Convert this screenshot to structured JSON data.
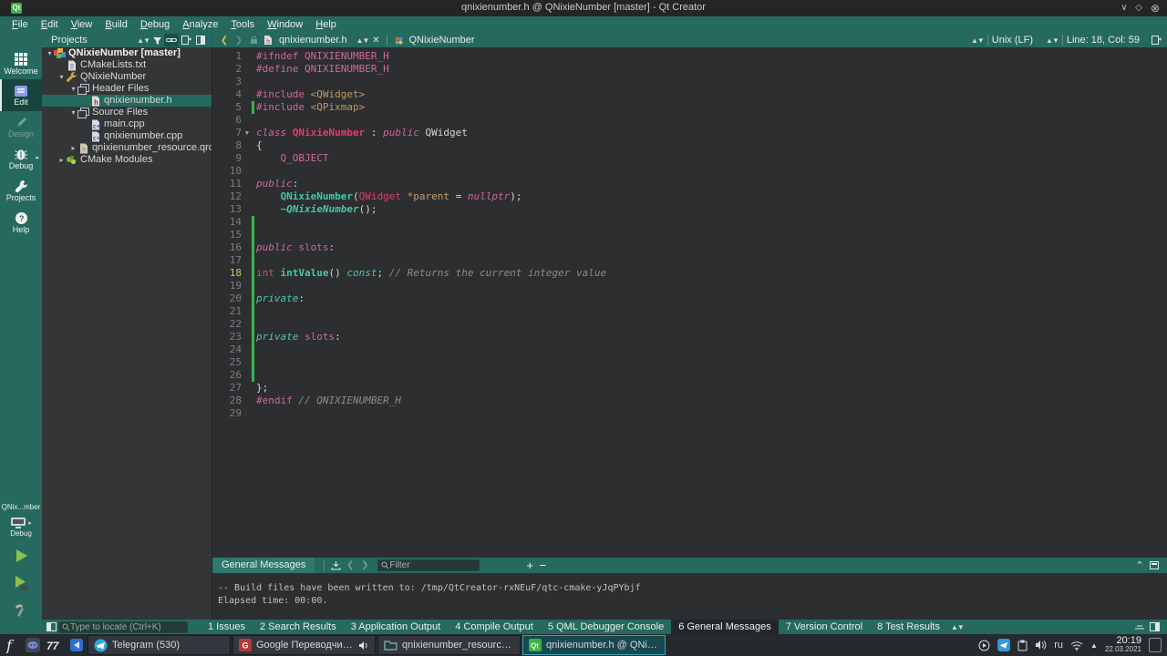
{
  "window": {
    "title": "qnixienumber.h @ QNixieNumber [master] - Qt Creator",
    "controls": [
      "minimize",
      "maximize",
      "close"
    ]
  },
  "menu_bar": {
    "items": [
      "File",
      "Edit",
      "View",
      "Build",
      "Debug",
      "Analyze",
      "Tools",
      "Window",
      "Help"
    ]
  },
  "toolbar": {
    "panel_selector": "Projects",
    "open_document": "qnixienumber.h",
    "symbol_selector": "QNixieNumber",
    "line_ending": "Unix (LF)",
    "cursor_position": "Line: 18, Col: 59"
  },
  "mode_sidebar": {
    "modes": [
      {
        "label": "Welcome",
        "icon": "welcome-grid-icon",
        "state": "normal"
      },
      {
        "label": "Edit",
        "icon": "edit-document-icon",
        "state": "selected"
      },
      {
        "label": "Design",
        "icon": "design-pencil-icon",
        "state": "disabled"
      },
      {
        "label": "Debug",
        "icon": "debug-bug-icon",
        "state": "normal",
        "has_arrow": true
      },
      {
        "label": "Projects",
        "icon": "projects-wrench-icon",
        "state": "normal"
      },
      {
        "label": "Help",
        "icon": "help-question-icon",
        "state": "normal"
      }
    ],
    "kit": {
      "target": "QNix...mber",
      "build_config": "Debug"
    }
  },
  "project_tree": {
    "items": [
      {
        "depth": 0,
        "arrow": "expanded",
        "icon": "project-icon",
        "label": "QNixieNumber [master]",
        "bold": true,
        "selected": false
      },
      {
        "depth": 1,
        "arrow": "none",
        "icon": "file-txt-icon",
        "label": "CMakeLists.txt",
        "bold": false,
        "selected": false
      },
      {
        "depth": 1,
        "arrow": "expanded",
        "icon": "wrench-icon",
        "label": "QNixieNumber",
        "bold": false,
        "selected": false
      },
      {
        "depth": 2,
        "arrow": "expanded",
        "icon": "folder-group-icon",
        "label": "Header Files",
        "bold": false,
        "selected": false
      },
      {
        "depth": 3,
        "arrow": "none",
        "icon": "file-h-icon",
        "label": "qnixienumber.h",
        "bold": false,
        "selected": true
      },
      {
        "depth": 2,
        "arrow": "expanded",
        "icon": "folder-group-icon",
        "label": "Source Files",
        "bold": false,
        "selected": false
      },
      {
        "depth": 3,
        "arrow": "none",
        "icon": "file-cpp-icon",
        "label": "main.cpp",
        "bold": false,
        "selected": false
      },
      {
        "depth": 3,
        "arrow": "none",
        "icon": "file-cpp-icon",
        "label": "qnixienumber.cpp",
        "bold": false,
        "selected": false
      },
      {
        "depth": 2,
        "arrow": "collapsed",
        "icon": "file-qrc-icon",
        "label": "qnixienumber_resource.qrc",
        "bold": false,
        "selected": false
      },
      {
        "depth": 1,
        "arrow": "collapsed",
        "icon": "cmake-modules-icon",
        "label": "CMake Modules",
        "bold": false,
        "selected": false
      }
    ]
  },
  "editor": {
    "current_line": 18,
    "fold_line": 7,
    "changed_lines": [
      5,
      14,
      15,
      16,
      17,
      18,
      19,
      20,
      21,
      22,
      23,
      24,
      25,
      26
    ],
    "lines": [
      {
        "n": 1,
        "t": [
          [
            "#ifndef QNIXIENUMBER_H",
            "pre"
          ]
        ]
      },
      {
        "n": 2,
        "t": [
          [
            "#define QNIXIENUMBER_H",
            "pre"
          ]
        ]
      },
      {
        "n": 3,
        "t": []
      },
      {
        "n": 4,
        "t": [
          [
            "#include ",
            "pre"
          ],
          [
            "<QWidget>",
            "str"
          ]
        ]
      },
      {
        "n": 5,
        "t": [
          [
            "#include ",
            "pre"
          ],
          [
            "<QPixmap>",
            "str"
          ]
        ]
      },
      {
        "n": 6,
        "t": []
      },
      {
        "n": 7,
        "t": [
          [
            "class ",
            "kw"
          ],
          [
            "QNixieNumber",
            "cls"
          ],
          [
            " : ",
            "txt"
          ],
          [
            "public",
            "kw"
          ],
          [
            " QWidget",
            "txt"
          ]
        ]
      },
      {
        "n": 8,
        "t": [
          [
            "{",
            "txt"
          ]
        ]
      },
      {
        "n": 9,
        "t": [
          [
            "    Q_OBJECT",
            "pre"
          ]
        ]
      },
      {
        "n": 10,
        "t": []
      },
      {
        "n": 11,
        "t": [
          [
            "public",
            "kw"
          ],
          [
            ":",
            "txt"
          ]
        ]
      },
      {
        "n": 12,
        "t": [
          [
            "    ",
            "txt"
          ],
          [
            "QNixieNumber",
            "fn"
          ],
          [
            "(",
            "txt"
          ],
          [
            "QWidget",
            "typ"
          ],
          [
            " ",
            "txt"
          ],
          [
            "*parent",
            "par"
          ],
          [
            " = ",
            "txt"
          ],
          [
            "nullptr",
            "kw"
          ],
          [
            ");",
            "txt"
          ]
        ]
      },
      {
        "n": 13,
        "t": [
          [
            "    ",
            "txt"
          ],
          [
            "~QNixieNumber",
            "fni"
          ],
          [
            "();",
            "txt"
          ]
        ]
      },
      {
        "n": 14,
        "t": []
      },
      {
        "n": 15,
        "t": []
      },
      {
        "n": 16,
        "t": [
          [
            "public",
            "kw"
          ],
          [
            " ",
            "txt"
          ],
          [
            "slots",
            "pre"
          ],
          [
            ":",
            "txt"
          ]
        ]
      },
      {
        "n": 17,
        "t": []
      },
      {
        "n": 18,
        "t": [
          [
            "int",
            "int"
          ],
          [
            " ",
            "txt"
          ],
          [
            "intValue",
            "fn"
          ],
          [
            "()",
            "txt"
          ],
          [
            " ",
            "txt"
          ],
          [
            "const",
            "kw2"
          ],
          [
            "; ",
            "txt"
          ],
          [
            "// Returns the current integer value",
            "cmt"
          ]
        ]
      },
      {
        "n": 19,
        "t": []
      },
      {
        "n": 20,
        "t": [
          [
            "private",
            "kw2"
          ],
          [
            ":",
            "txt"
          ]
        ]
      },
      {
        "n": 21,
        "t": []
      },
      {
        "n": 22,
        "t": []
      },
      {
        "n": 23,
        "t": [
          [
            "private",
            "kw2"
          ],
          [
            " ",
            "txt"
          ],
          [
            "slots",
            "pre"
          ],
          [
            ":",
            "txt"
          ]
        ]
      },
      {
        "n": 24,
        "t": []
      },
      {
        "n": 25,
        "t": []
      },
      {
        "n": 26,
        "t": []
      },
      {
        "n": 27,
        "t": [
          [
            "};",
            "txt"
          ]
        ]
      },
      {
        "n": 28,
        "t": [
          [
            "#endif ",
            "pre"
          ],
          [
            "// QNIXIENUMBER_H",
            "cmt"
          ]
        ]
      },
      {
        "n": 29,
        "t": []
      }
    ]
  },
  "output_pane": {
    "title": "General Messages",
    "filter_placeholder": "Filter",
    "lines": [
      "-- Build files have been written to: /tmp/QtCreator-rxNEuF/qtc-cmake-yJqPYbjf",
      "Elapsed time: 00:00."
    ]
  },
  "status_bar": {
    "locate_placeholder": "Type to locate (Ctrl+K)",
    "tabs": [
      {
        "label": "1 Issues",
        "active": false
      },
      {
        "label": "2 Search Results",
        "active": false
      },
      {
        "label": "3 Application Output",
        "active": false
      },
      {
        "label": "4 Compile Output",
        "active": false
      },
      {
        "label": "5 QML Debugger Console",
        "active": false
      },
      {
        "label": "6 General Messages",
        "active": true
      },
      {
        "label": "7 Version Control",
        "active": false
      },
      {
        "label": "8 Test Results",
        "active": false
      }
    ]
  },
  "taskbar": {
    "launchers": [
      {
        "icon": "f-app-icon"
      },
      {
        "icon": "discord-icon"
      },
      {
        "icon": "seventy-seven-icon"
      },
      {
        "icon": "blue-app-icon"
      }
    ],
    "windows": [
      {
        "label": "Telegram (530)",
        "icon": "telegram-icon",
        "active": false,
        "speaker": false
      },
      {
        "label": "Google Переводчик — ...",
        "icon": "translator-icon",
        "active": false,
        "speaker": true
      },
      {
        "label": "qnixienumber_resource — D...",
        "icon": "folder-window-icon",
        "active": false,
        "speaker": false
      },
      {
        "label": "qnixienumber.h @ QNixieNu...",
        "icon": "qtcreator-icon",
        "active": true,
        "speaker": false
      }
    ],
    "tray": {
      "keyboard_layout": "ru",
      "time": "20:19",
      "date": "22.03.2021"
    }
  },
  "glyphs": {
    "expanded": "▾",
    "collapsed": "▸",
    "tray_expand": "▲",
    "minimize": "∨",
    "maximize": "◇",
    "close": "⊗"
  },
  "colors": {
    "teal": "#26695e",
    "editor_bg": "#2c2e30",
    "panel_bg": "#333537",
    "selection": "#23695e",
    "change_bar": "#37b24d",
    "accent_green": "#3fae49"
  }
}
